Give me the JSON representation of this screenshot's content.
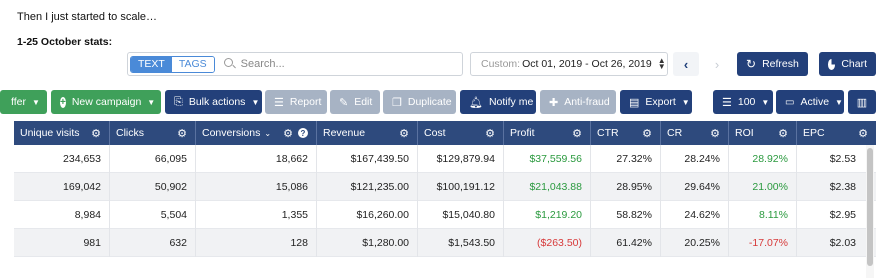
{
  "intro_text": "Then I just started to scale…",
  "subheading": "1-25 October stats:",
  "search": {
    "tab_text": "TEXT",
    "tab_tags": "TAGS",
    "placeholder": "Search..."
  },
  "date_filter": {
    "prefix": "Custom:",
    "range": "Oct 01, 2019 - Oct 26, 2019"
  },
  "buttons": {
    "refresh": "Refresh",
    "chart": "Chart",
    "offer": "ffer",
    "new_campaign": "New campaign",
    "bulk_actions": "Bulk actions",
    "report": "Report",
    "edit": "Edit",
    "duplicate": "Duplicate",
    "notify_me": "Notify me",
    "anti_fraud": "Anti-fraud",
    "export": "Export",
    "rows_per_page": "100",
    "status_filter": "Active"
  },
  "colors": {
    "navy": "#23407a",
    "green": "#3fa05a",
    "grey_button": "#a7b3c4",
    "header": "#2e4a7d",
    "positive": "#2b9a3f",
    "negative": "#d73a3a"
  },
  "table": {
    "columns": [
      "Unique visits",
      "Clicks",
      "Conversions",
      "Revenue",
      "Cost",
      "Profit",
      "CTR",
      "CR",
      "ROI",
      "EPC"
    ],
    "rows": [
      [
        "234,653",
        "66,095",
        "18,662",
        "$167,439.50",
        "$129,879.94",
        "$37,559.56",
        "27.32%",
        "28.24%",
        "28.92%",
        "$2.53"
      ],
      [
        "169,042",
        "50,902",
        "15,086",
        "$121,235.00",
        "$100,191.12",
        "$21,043.88",
        "28.95%",
        "29.64%",
        "21.00%",
        "$2.38"
      ],
      [
        "8,984",
        "5,504",
        "1,355",
        "$16,260.00",
        "$15,040.80",
        "$1,219.20",
        "58.82%",
        "24.62%",
        "8.11%",
        "$2.95"
      ],
      [
        "981",
        "632",
        "128",
        "$1,280.00",
        "$1,543.50",
        "($263.50)",
        "61.42%",
        "20.25%",
        "-17.07%",
        "$2.03"
      ]
    ]
  }
}
